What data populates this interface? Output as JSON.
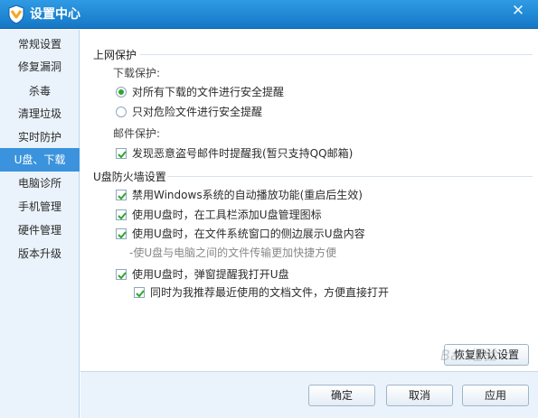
{
  "window": {
    "title": "设置中心",
    "close_symbol": "✕"
  },
  "sidebar": {
    "items": [
      {
        "label": "常规设置"
      },
      {
        "label": "修复漏洞"
      },
      {
        "label": "杀毒"
      },
      {
        "label": "清理垃圾"
      },
      {
        "label": "实时防护"
      },
      {
        "label": "U盘、下载"
      },
      {
        "label": "电脑诊所"
      },
      {
        "label": "手机管理"
      },
      {
        "label": "硬件管理"
      },
      {
        "label": "版本升级"
      }
    ],
    "active_index": 5
  },
  "internet_protection": {
    "title": "上网保护",
    "download_label": "下载保护:",
    "radio_all": {
      "label": "对所有下载的文件进行安全提醒",
      "selected": true
    },
    "radio_danger": {
      "label": "只对危险文件进行安全提醒",
      "selected": false
    },
    "mail_label": "邮件保护:",
    "mail_check": {
      "label": "发现恶意盗号邮件时提醒我(暂只支持QQ邮箱)",
      "checked": true
    }
  },
  "usb_firewall": {
    "title": "U盘防火墙设置",
    "disable_autoplay": {
      "label": "禁用Windows系统的自动播放功能(重启后生效)",
      "checked": true
    },
    "toolbar_icon": {
      "label": "使用U盘时，在工具栏添加U盘管理图标",
      "checked": true
    },
    "side_view": {
      "label": "使用U盘时，在文件系统窗口的侧边展示U盘内容",
      "checked": true
    },
    "side_view_note": "-使U盘与电脑之间的文件传输更加快捷方便",
    "popup_open": {
      "label": "使用U盘时，弹窗提醒我打开U盘",
      "checked": true
    },
    "recommend_docs": {
      "label": "同时为我推荐最近使用的文档文件，方便直接打开",
      "checked": true
    }
  },
  "buttons": {
    "restore_default": "恢复默认设置",
    "ok": "确定",
    "cancel": "取消",
    "apply": "应用"
  },
  "watermark": "Bai 经验",
  "colors": {
    "title_bar": "#1f88d6",
    "active_tab": "#3a93dc",
    "check_green": "#2fa52f",
    "sidebar_bg": "#eaf3fb"
  },
  "icons": {
    "logo": "qq-pc-manager-shield-icon",
    "close": "close-icon",
    "radio": "radio-button-icon",
    "checkbox": "checkmark-icon"
  }
}
